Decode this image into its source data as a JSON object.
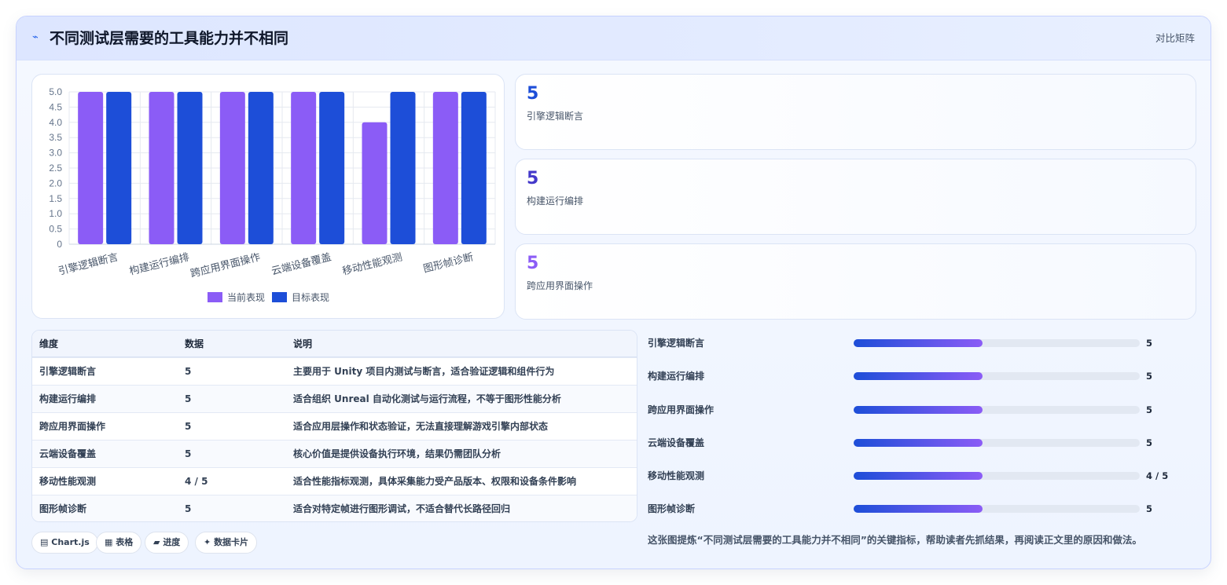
{
  "header": {
    "title": "不同测试层需要的工具能力并不相同",
    "tag": "对比矩阵",
    "icon": "spark-icon"
  },
  "colors": {
    "current": "#8b5cf6",
    "target": "#1d4ed8",
    "stat1": "#1d4ed8",
    "stat2": "#4338ca",
    "stat3": "#8b5cf6"
  },
  "chart_data": {
    "type": "bar",
    "categories": [
      "引擎逻辑断言",
      "构建运行编排",
      "跨应用界面操作",
      "云端设备覆盖",
      "移动性能观测",
      "图形帧诊断"
    ],
    "series": [
      {
        "name": "当前表现",
        "values": [
          5,
          5,
          5,
          5,
          4,
          5
        ],
        "color": "#8b5cf6"
      },
      {
        "name": "目标表现",
        "values": [
          5,
          5,
          5,
          5,
          5,
          5
        ],
        "color": "#1d4ed8"
      }
    ],
    "ylim": [
      0,
      5
    ],
    "yticks": [
      "5.0",
      "4.5",
      "4.0",
      "3.5",
      "3.0",
      "2.5",
      "2.0",
      "1.5",
      "1.0",
      "0.5",
      "0"
    ],
    "grid": true,
    "legend": "bottom"
  },
  "stats": [
    {
      "value": "5",
      "label": "引擎逻辑断言"
    },
    {
      "value": "5",
      "label": "构建运行编排"
    },
    {
      "value": "5",
      "label": "跨应用界面操作"
    }
  ],
  "table": {
    "headers": [
      "维度",
      "数据",
      "说明"
    ],
    "rows": [
      [
        "引擎逻辑断言",
        "5",
        "主要用于 Unity 项目内测试与断言，适合验证逻辑和组件行为"
      ],
      [
        "构建运行编排",
        "5",
        "适合组织 Unreal 自动化测试与运行流程，不等于图形性能分析"
      ],
      [
        "跨应用界面操作",
        "5",
        "适合应用层操作和状态验证，无法直接理解游戏引擎内部状态"
      ],
      [
        "云端设备覆盖",
        "5",
        "核心价值是提供设备执行环境，结果仍需团队分析"
      ],
      [
        "移动性能观测",
        "4 / 5",
        "适合性能指标观测，具体采集能力受产品版本、权限和设备条件影响"
      ],
      [
        "图形帧诊断",
        "5",
        "适合对特定帧进行图形调试，不适合替代长路径回归"
      ]
    ]
  },
  "chips": [
    {
      "icon": "chart-icon",
      "glyph": "▤",
      "label": "Chart.js"
    },
    {
      "icon": "table-icon",
      "glyph": "▦",
      "label": "表格"
    },
    {
      "icon": "progress-icon",
      "glyph": "▰",
      "label": "进度"
    },
    {
      "icon": "card-icon",
      "glyph": "✦",
      "label": "数据卡片"
    }
  ],
  "progress": [
    {
      "label": "引擎逻辑断言",
      "value": "5",
      "fraction": 0.45
    },
    {
      "label": "构建运行编排",
      "value": "5",
      "fraction": 0.45
    },
    {
      "label": "跨应用界面操作",
      "value": "5",
      "fraction": 0.45
    },
    {
      "label": "云端设备覆盖",
      "value": "5",
      "fraction": 0.45
    },
    {
      "label": "移动性能观测",
      "value": "4 / 5",
      "fraction": 0.45
    },
    {
      "label": "图形帧诊断",
      "value": "5",
      "fraction": 0.45
    }
  ],
  "footnote": "这张图提炼“不同测试层需要的工具能力并不相同”的关键指标，帮助读者先抓结果，再阅读正文里的原因和做法。"
}
